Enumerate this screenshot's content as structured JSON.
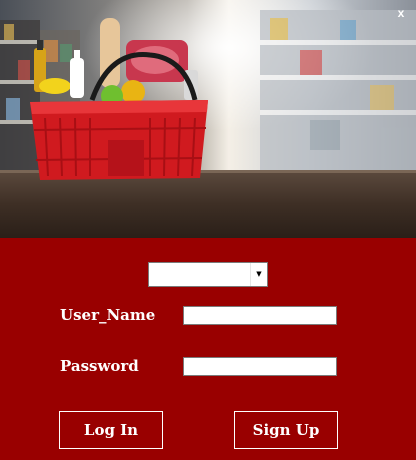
{
  "window": {
    "close_label": "x"
  },
  "form": {
    "role_select": {
      "value": ""
    },
    "username": {
      "label": "User_Name",
      "value": ""
    },
    "password": {
      "label": "Password",
      "value": ""
    },
    "login_label": "Log In",
    "signup_label": "Sign Up"
  },
  "colors": {
    "panel_background": "#990000",
    "button_border": "#ffffff",
    "text": "#ffffff"
  },
  "icons": {
    "close": "close-icon",
    "dropdown": "chevron-down-icon"
  }
}
